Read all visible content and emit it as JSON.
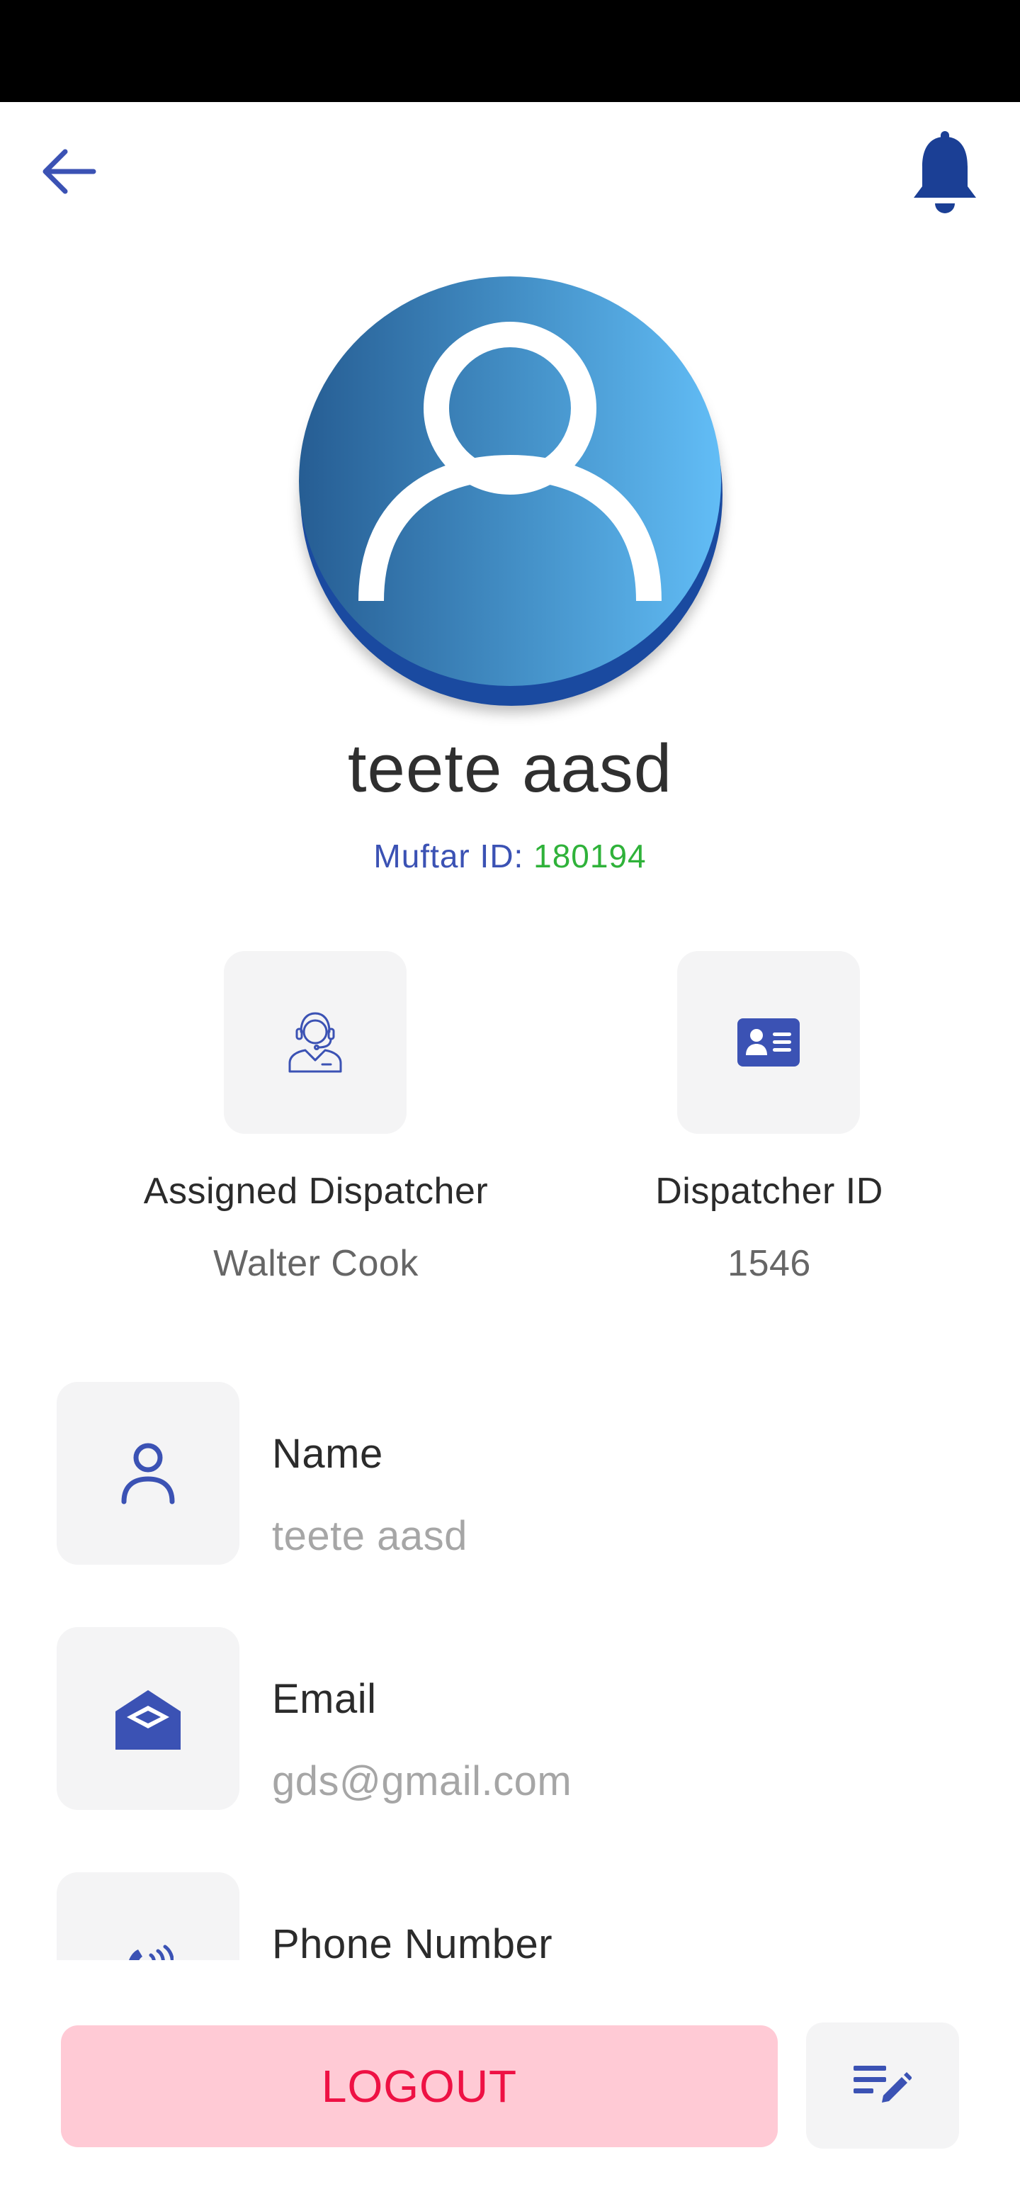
{
  "profile": {
    "name": "teete aasd",
    "id_label": "Muftar ID:",
    "id_value": "180194"
  },
  "cards": [
    {
      "title": "Assigned Dispatcher",
      "value": "Walter Cook",
      "icon": "dispatcher-headset-icon"
    },
    {
      "title": "Dispatcher ID",
      "value": "1546",
      "icon": "id-card-icon"
    }
  ],
  "fields": [
    {
      "label": "Name",
      "value": "teete aasd",
      "icon": "person-icon"
    },
    {
      "label": "Email",
      "value": "gds@gmail.com",
      "icon": "envelope-icon"
    },
    {
      "label": "Phone Number",
      "value": "",
      "icon": "phone-icon"
    }
  ],
  "actions": {
    "logout_label": "LOGOUT",
    "edit_icon": "edit-list-icon"
  },
  "header": {
    "back_icon": "back-arrow-icon",
    "notification_icon": "bell-icon"
  },
  "colors": {
    "accent": "#3b52b4",
    "id_value": "#2fb23a",
    "logout_bg": "#ffcad5",
    "logout_text": "#ee1144",
    "tile_bg": "#f4f4f5"
  }
}
